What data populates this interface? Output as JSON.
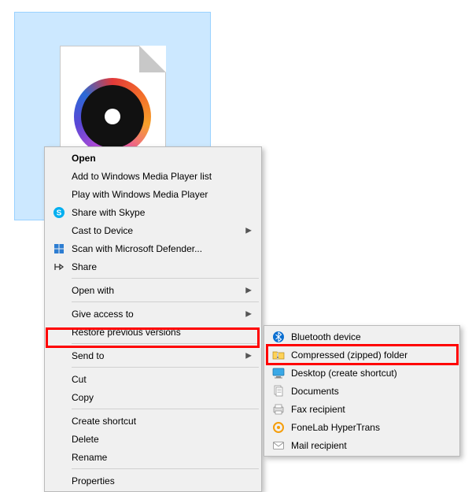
{
  "file": {
    "selected": true,
    "icon": "music-disc"
  },
  "contextMenu": {
    "groups": [
      [
        {
          "label": "Open",
          "bold": true,
          "icon": null,
          "submenu": false
        },
        {
          "label": "Add to Windows Media Player list",
          "icon": null,
          "submenu": false
        },
        {
          "label": "Play with Windows Media Player",
          "icon": null,
          "submenu": false
        },
        {
          "label": "Share with Skype",
          "icon": "skype",
          "submenu": false
        },
        {
          "label": "Cast to Device",
          "icon": null,
          "submenu": true
        },
        {
          "label": "Scan with Microsoft Defender...",
          "icon": "defender",
          "submenu": false
        },
        {
          "label": "Share",
          "icon": "share",
          "submenu": false
        }
      ],
      [
        {
          "label": "Open with",
          "icon": null,
          "submenu": true
        }
      ],
      [
        {
          "label": "Give access to",
          "icon": null,
          "submenu": true
        },
        {
          "label": "Restore previous versions",
          "icon": null,
          "submenu": false
        }
      ],
      [
        {
          "label": "Send to",
          "icon": null,
          "submenu": true,
          "highlighted": true
        }
      ],
      [
        {
          "label": "Cut",
          "icon": null,
          "submenu": false
        },
        {
          "label": "Copy",
          "icon": null,
          "submenu": false
        }
      ],
      [
        {
          "label": "Create shortcut",
          "icon": null,
          "submenu": false
        },
        {
          "label": "Delete",
          "icon": null,
          "submenu": false
        },
        {
          "label": "Rename",
          "icon": null,
          "submenu": false
        }
      ],
      [
        {
          "label": "Properties",
          "icon": null,
          "submenu": false
        }
      ]
    ]
  },
  "sendToSubmenu": {
    "items": [
      {
        "label": "Bluetooth device",
        "icon": "bluetooth"
      },
      {
        "label": "Compressed (zipped) folder",
        "icon": "zipped",
        "highlighted": true
      },
      {
        "label": "Desktop (create shortcut)",
        "icon": "desktop"
      },
      {
        "label": "Documents",
        "icon": "documents"
      },
      {
        "label": "Fax recipient",
        "icon": "fax"
      },
      {
        "label": "FoneLab HyperTrans",
        "icon": "fonelab"
      },
      {
        "label": "Mail recipient",
        "icon": "mail"
      }
    ]
  }
}
